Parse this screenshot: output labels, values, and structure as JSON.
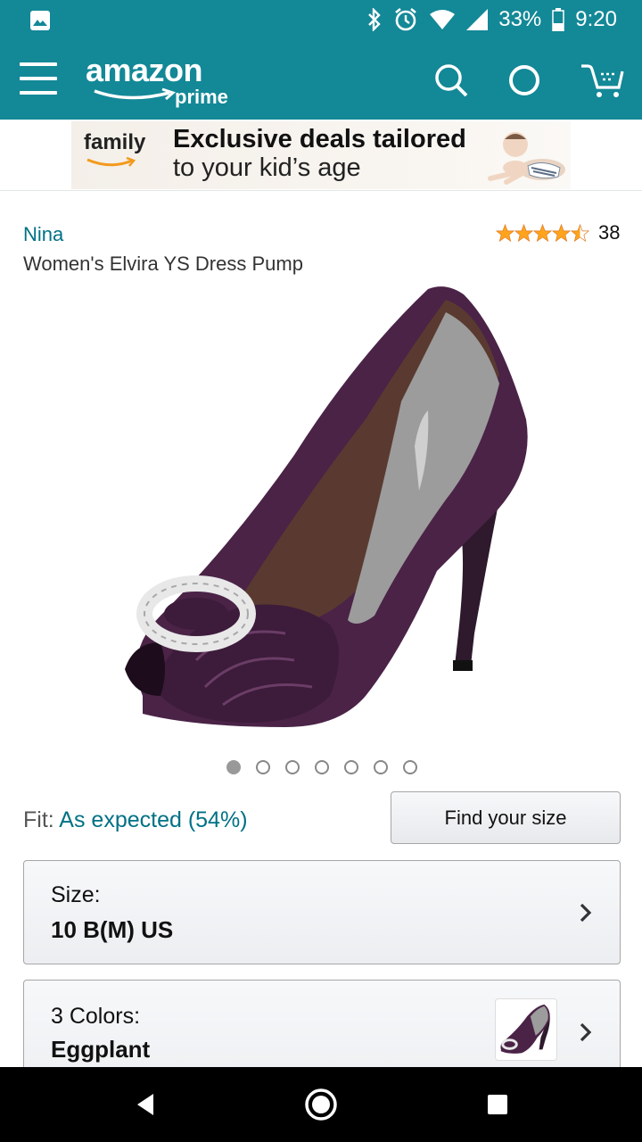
{
  "status_bar": {
    "battery": "33%",
    "time": "9:20",
    "icons": [
      "gallery-icon",
      "bluetooth-icon",
      "alarm-icon",
      "wifi-icon",
      "signal-icon",
      "battery-icon"
    ]
  },
  "header": {
    "logo_word": "amazon",
    "logo_sub": "prime",
    "icons": [
      "menu-icon",
      "search-icon",
      "alexa-icon",
      "cart-icon"
    ],
    "bg_color": "#138897"
  },
  "banner": {
    "family": "family",
    "line1": "Exclusive deals tailored",
    "line2": "to your kid’s age"
  },
  "product": {
    "brand": "Nina",
    "title": "Women's Elvira YS Dress Pump",
    "rating_stars": 4.5,
    "rating_count": "38",
    "image_count": 7,
    "active_image": 1
  },
  "fit": {
    "label": "Fit:",
    "value": "As expected (54%)",
    "button": "Find your size"
  },
  "size": {
    "label": "Size:",
    "value": "10 B(M) US"
  },
  "colors": {
    "label": "3 Colors:",
    "value": "Eggplant"
  },
  "nav": {
    "icons": [
      "back-icon",
      "home-icon",
      "recents-icon"
    ]
  },
  "colors_theme": {
    "teal": "#138897",
    "link": "#007185",
    "star": "#ffa41c",
    "shoe": "#4a2347"
  }
}
